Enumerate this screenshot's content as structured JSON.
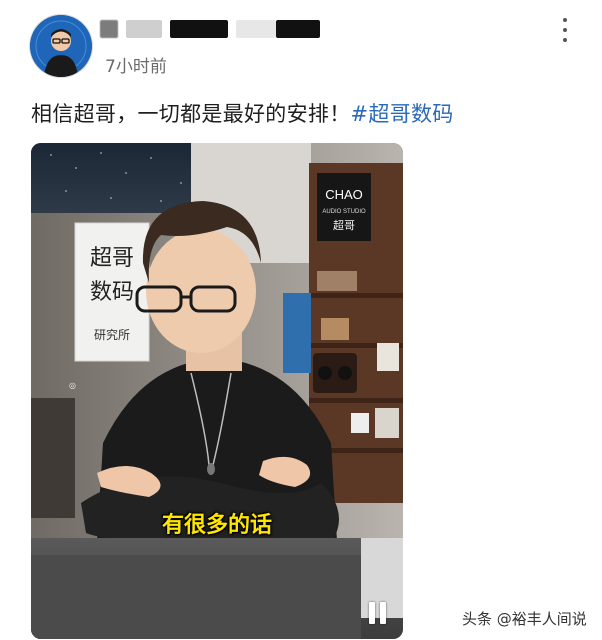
{
  "post": {
    "time": "7小时前",
    "text": "相信超哥，一切都是最好的安排！",
    "hashtag": "#超哥数码"
  },
  "video": {
    "subtitle": "有很多的话",
    "poster_text": "超哥数码研究所",
    "store_sign": "CHAO",
    "store_sign_sub": "AUDIO STUDIO"
  },
  "watermark": "头条 @裕丰人间说",
  "icons": [
    "avatar",
    "more-options-icon",
    "pause-icon"
  ],
  "colors": {
    "hashtag": "#2a6ab8",
    "subtitle": "#ffe600"
  }
}
